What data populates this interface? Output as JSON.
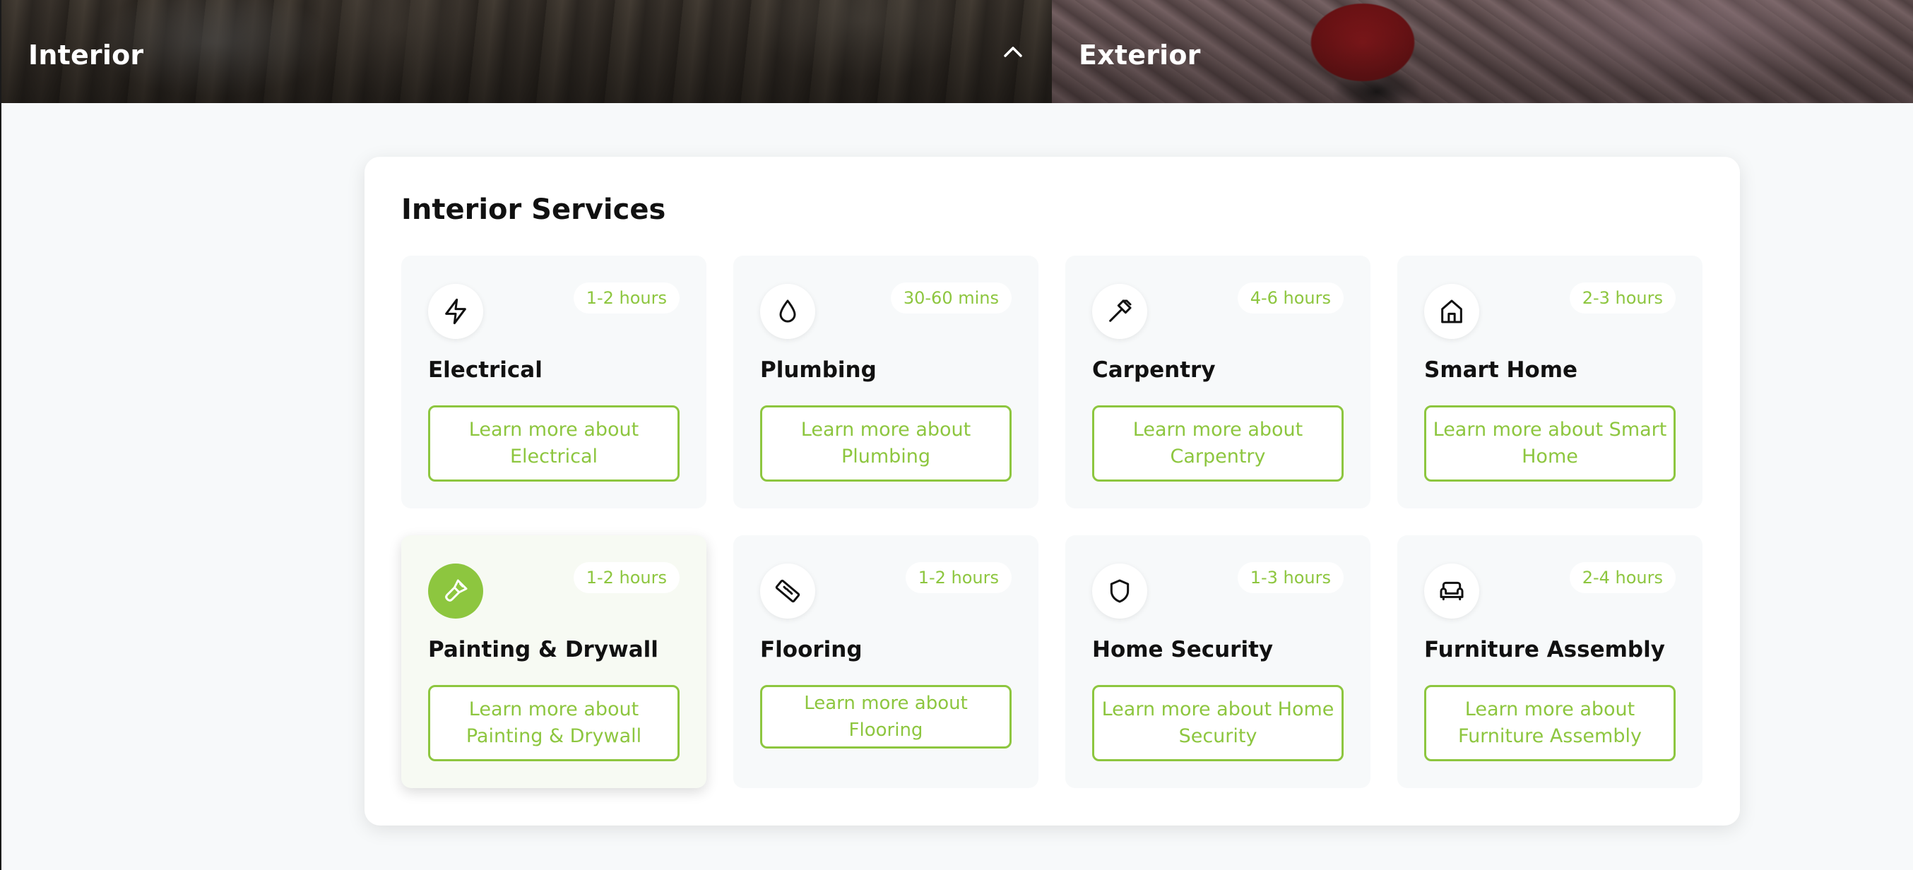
{
  "banner": {
    "interior": {
      "title": "Interior",
      "expanded": true
    },
    "exterior": {
      "title": "Exterior"
    }
  },
  "section": {
    "title": "Interior Services"
  },
  "colors": {
    "accent": "#8dc63f",
    "text": "#111111",
    "card_bg": "#f7f9fa"
  },
  "services": [
    {
      "name": "Electrical",
      "duration": "1-2 hours",
      "button": "Learn more about Electrical",
      "icon": "lightning-icon"
    },
    {
      "name": "Plumbing",
      "duration": "30-60 mins",
      "button": "Learn more about Plumbing",
      "icon": "droplet-icon"
    },
    {
      "name": "Carpentry",
      "duration": "4-6 hours",
      "button": "Learn more about Carpentry",
      "icon": "hammer-icon"
    },
    {
      "name": "Smart Home",
      "duration": "2-3 hours",
      "button": "Learn more about Smart Home",
      "icon": "home-icon"
    },
    {
      "name": "Painting & Drywall",
      "duration": "1-2 hours",
      "button": "Learn more about Painting & Drywall",
      "icon": "paintbrush-icon",
      "active": true
    },
    {
      "name": "Flooring",
      "duration": "1-2 hours",
      "button": "Learn more about Flooring",
      "icon": "ruler-icon"
    },
    {
      "name": "Home Security",
      "duration": "1-3 hours",
      "button": "Learn more about Home Security",
      "icon": "shield-icon"
    },
    {
      "name": "Furniture Assembly",
      "duration": "2-4 hours",
      "button": "Learn more about Furniture Assembly",
      "icon": "sofa-icon"
    }
  ]
}
